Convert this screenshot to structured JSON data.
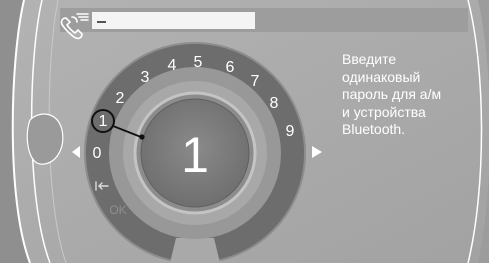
{
  "screen": {
    "colors": {
      "background": "#a7a7a7",
      "panel_text": "#ffffff",
      "wheel_ring": "#707070",
      "wheel_center": "#7f7f7f"
    }
  },
  "header": {
    "pairing_icon": "bluetooth-pairing-icon",
    "input_value": "_"
  },
  "wheel": {
    "digits": [
      "0",
      "1",
      "2",
      "3",
      "4",
      "5",
      "6",
      "7",
      "8",
      "9"
    ],
    "selected_digit": "1",
    "center_value": "1",
    "backspace_icon": "backspace-icon",
    "ok_label": "OK"
  },
  "navigation": {
    "left_arrow_icon": "arrow-left-icon",
    "right_arrow_icon": "arrow-right-icon"
  },
  "instruction": {
    "lines": [
      "Введите",
      "одинаковый",
      "пароль для а/м",
      "и устройства",
      "Bluetooth."
    ]
  }
}
